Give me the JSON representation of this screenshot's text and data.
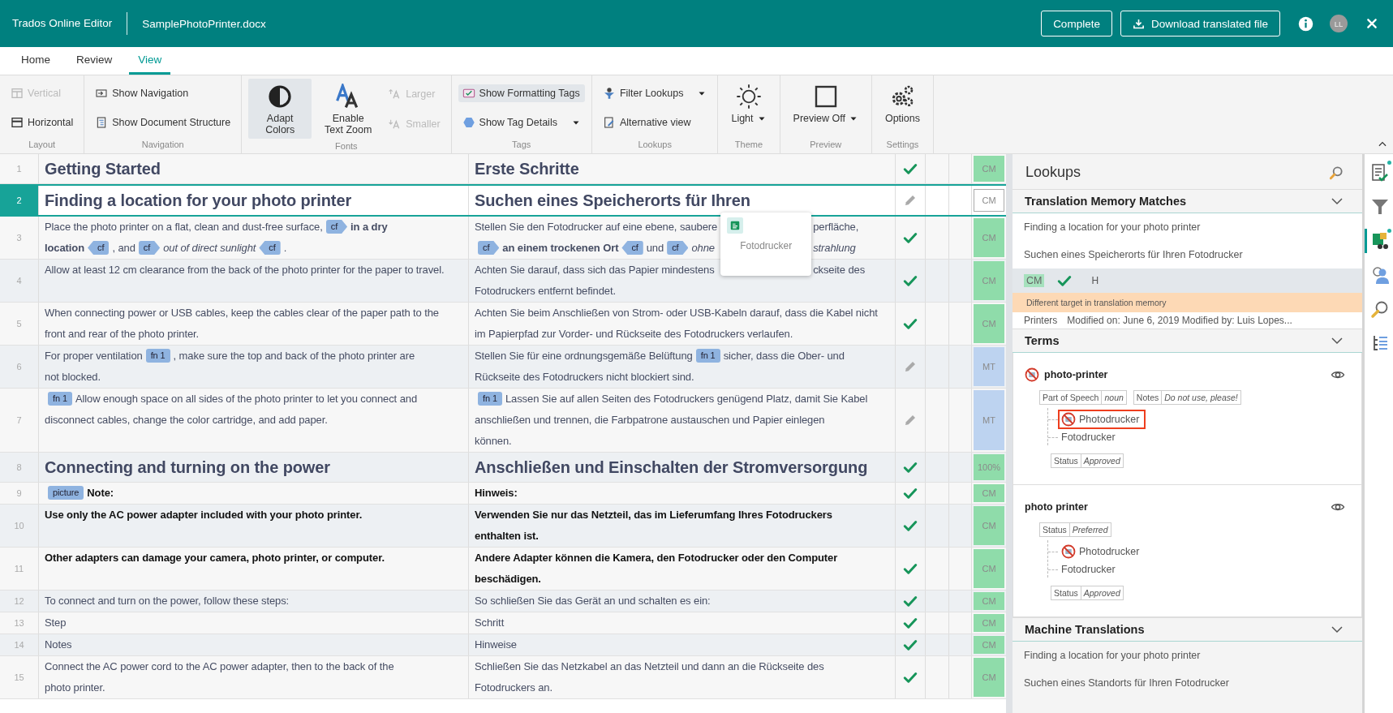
{
  "header": {
    "app_title": "Trados Online Editor",
    "file_name": "SamplePhotoPrinter.docx",
    "buttons": [
      {
        "label": "Complete",
        "kind": "plain"
      },
      {
        "label": "Download translated file",
        "kind": "download"
      }
    ],
    "avatar": "LL"
  },
  "tabs": [
    {
      "label": "Home",
      "selected": false
    },
    {
      "label": "Review",
      "selected": false
    },
    {
      "label": "View",
      "selected": true
    }
  ],
  "ribbon": {
    "groups": [
      {
        "label": "Layout",
        "items": [
          {
            "label": "Vertical",
            "kind": "small",
            "disabled": true,
            "active": false,
            "dropdown": false
          },
          {
            "label": "Horizontal",
            "kind": "small",
            "disabled": false,
            "active": false,
            "dropdown": false
          }
        ]
      },
      {
        "label": "Navigation",
        "items": [
          {
            "label": "Show Navigation",
            "kind": "small",
            "disabled": false,
            "active": false,
            "dropdown": false
          },
          {
            "label": "Show Document Structure",
            "kind": "small",
            "disabled": false,
            "active": false,
            "dropdown": false
          }
        ]
      },
      {
        "label": "Fonts",
        "items": [
          {
            "label": "Adapt Colors",
            "kind": "large",
            "disabled": false,
            "active": true,
            "dropdown": false
          },
          {
            "label": "Enable Text Zoom",
            "kind": "large",
            "disabled": false,
            "active": false,
            "dropdown": false
          },
          {
            "label": "Larger",
            "kind": "small",
            "disabled": true,
            "active": false,
            "dropdown": false
          },
          {
            "label": "Smaller",
            "kind": "small",
            "disabled": true,
            "active": false,
            "dropdown": false
          }
        ]
      },
      {
        "label": "Tags",
        "items": [
          {
            "label": "Show Formatting Tags",
            "kind": "small",
            "disabled": false,
            "active": true,
            "dropdown": false
          },
          {
            "label": "Show Tag Details",
            "kind": "small",
            "disabled": false,
            "active": false,
            "dropdown": true
          }
        ]
      },
      {
        "label": "Lookups",
        "items": [
          {
            "label": "Filter Lookups",
            "kind": "small",
            "disabled": false,
            "active": false,
            "dropdown": true
          },
          {
            "label": "Alternative view",
            "kind": "small",
            "disabled": false,
            "active": false,
            "dropdown": false
          }
        ]
      },
      {
        "label": "Theme",
        "items": [
          {
            "label": "Light",
            "kind": "large",
            "disabled": false,
            "active": false,
            "dropdown": true
          }
        ]
      },
      {
        "label": "Preview",
        "items": [
          {
            "label": "Preview Off",
            "kind": "large",
            "disabled": false,
            "active": false,
            "dropdown": true
          }
        ]
      },
      {
        "label": "Settings",
        "items": [
          {
            "label": "Options",
            "kind": "large",
            "disabled": false,
            "active": false,
            "dropdown": false
          }
        ]
      }
    ]
  },
  "rows": [
    {
      "number": "1",
      "kind": "heading",
      "selected": false,
      "confirmed": true,
      "match": "CM",
      "color": "#8fdcaa",
      "source": [
        {
          "kind": "text",
          "s": "Getting Started"
        }
      ],
      "target": [
        {
          "kind": "text",
          "s": "Erste Schritte"
        }
      ]
    },
    {
      "number": "2",
      "kind": "heading",
      "selected": true,
      "confirmed": false,
      "match": "CM",
      "color": "#ffffff",
      "source": [
        {
          "kind": "text",
          "s": "Finding a location for your photo printer"
        }
      ],
      "target": [
        {
          "kind": "text",
          "s": "Suchen eines Speicherorts für Ihren"
        }
      ]
    },
    {
      "number": "3",
      "kind": "plain",
      "selected": false,
      "confirmed": true,
      "match": "CM",
      "color": "#8fdcaa",
      "source": [
        {
          "kind": "text",
          "s": "Place the photo printer on a flat, clean and dust-free surface,"
        },
        {
          "kind": "open_tag",
          "label": "cf"
        },
        {
          "kind": "text",
          "s": "**in a dry**"
        },
        {
          "kind": "break"
        },
        {
          "kind": "text",
          "s": "**location**"
        },
        {
          "kind": "close_tag",
          "label": "cf"
        },
        {
          "kind": "text",
          "s": ", and"
        },
        {
          "kind": "open_tag",
          "label": "cf"
        },
        {
          "kind": "text",
          "s": "*out of direct sunlight*"
        },
        {
          "kind": "close_tag",
          "label": "cf"
        },
        {
          "kind": "text",
          "s": "."
        }
      ],
      "target": [
        {
          "kind": "text",
          "s": "Stellen Sie den Fotodrucker auf eine ebene, saubere"
        },
        {
          "kind": "gap"
        },
        {
          "kind": "text",
          "s": "perfläche,"
        },
        {
          "kind": "break"
        },
        {
          "kind": "open_tag",
          "label": "cf"
        },
        {
          "kind": "text",
          "s": "**an einem trockenen Ort**"
        },
        {
          "kind": "close_tag",
          "label": "cf"
        },
        {
          "kind": "text",
          "s": "und"
        },
        {
          "kind": "open_tag",
          "label": "cf"
        },
        {
          "kind": "text",
          "s": "*ohne*"
        },
        {
          "kind": "gap"
        },
        {
          "kind": "text",
          "s": "*strahlung*"
        }
      ]
    },
    {
      "number": "4",
      "kind": "plain",
      "selected": false,
      "confirmed": true,
      "match": "CM",
      "color": "#8fdcaa",
      "source": [
        {
          "kind": "text",
          "s": "Allow at least 12 cm clearance from the back of the photo printer for the paper to travel."
        }
      ],
      "target": [
        {
          "kind": "text",
          "s": "Achten Sie darauf, dass sich das Papier mindestens"
        },
        {
          "kind": "gap"
        },
        {
          "kind": "text",
          "s": "ckseite des"
        },
        {
          "kind": "break"
        },
        {
          "kind": "text",
          "s": "Fotodruckers entfernt befindet."
        }
      ]
    },
    {
      "number": "5",
      "kind": "plain",
      "selected": false,
      "confirmed": true,
      "match": "CM",
      "color": "#8fdcaa",
      "source": [
        {
          "kind": "text",
          "s": "When connecting power or USB cables, keep the cables clear of the paper path to the front and rear of the photo printer."
        }
      ],
      "target": [
        {
          "kind": "text",
          "s": "Achten Sie beim Anschließen von Strom- oder USB-Kabeln darauf, dass die Kabel nicht im Papierpfad zur Vorder- und Rückseite des Fotodruckers verlaufen."
        }
      ]
    },
    {
      "number": "6",
      "kind": "plain",
      "selected": false,
      "confirmed": false,
      "match": "MT",
      "color": "#bdd3f0",
      "source": [
        {
          "kind": "text",
          "s": "For proper ventilation"
        },
        {
          "kind": "tag",
          "label": "fn 1"
        },
        {
          "kind": "text",
          "s": ", make sure the top and back of the photo printer are"
        },
        {
          "kind": "break"
        },
        {
          "kind": "text",
          "s": "not blocked."
        }
      ],
      "target": [
        {
          "kind": "text",
          "s": "Stellen Sie für eine ordnungsgemäße Belüftung"
        },
        {
          "kind": "tag",
          "label": "fn 1"
        },
        {
          "kind": "text",
          "s": "sicher, dass die Ober- und"
        },
        {
          "kind": "break"
        },
        {
          "kind": "text",
          "s": "Rückseite des Fotodruckers nicht blockiert sind."
        }
      ]
    },
    {
      "number": "7",
      "kind": "plain",
      "selected": false,
      "confirmed": false,
      "match": "MT",
      "color": "#bdd3f0",
      "source": [
        {
          "kind": "tag",
          "label": "fn 1"
        },
        {
          "kind": "text",
          "s": "Allow enough space on all sides of the photo printer to let you connect and"
        },
        {
          "kind": "break"
        },
        {
          "kind": "text",
          "s": "disconnect cables, change the color cartridge, and add paper."
        }
      ],
      "target": [
        {
          "kind": "tag",
          "label": "fn 1"
        },
        {
          "kind": "text",
          "s": "Lassen Sie auf allen Seiten des Fotodruckers genügend Platz, damit Sie Kabel"
        },
        {
          "kind": "break"
        },
        {
          "kind": "text",
          "s": "anschließen und trennen, die Farbpatrone austauschen und Papier einlegen"
        },
        {
          "kind": "break"
        },
        {
          "kind": "text",
          "s": "können."
        }
      ]
    },
    {
      "number": "8",
      "kind": "heading",
      "selected": false,
      "confirmed": true,
      "match": "100%",
      "color": "#8fdcaa",
      "source": [
        {
          "kind": "text",
          "s": "Connecting and turning on the power"
        }
      ],
      "target": [
        {
          "kind": "text",
          "s": "Anschließen und Einschalten der Stromversorgung"
        }
      ]
    },
    {
      "number": "9",
      "kind": "bold",
      "selected": false,
      "confirmed": true,
      "match": "CM",
      "color": "#8fdcaa",
      "source": [
        {
          "kind": "tag",
          "label": "picture"
        },
        {
          "kind": "text",
          "s": "Note:"
        }
      ],
      "target": [
        {
          "kind": "text",
          "s": "Hinweis:"
        }
      ]
    },
    {
      "number": "10",
      "kind": "bold",
      "selected": false,
      "confirmed": true,
      "match": "CM",
      "color": "#8fdcaa",
      "source": [
        {
          "kind": "text",
          "s": "Use only the AC power adapter included with your photo printer."
        }
      ],
      "target": [
        {
          "kind": "text",
          "s": "Verwenden Sie nur das Netzteil, das im Lieferumfang Ihres Fotodruckers"
        },
        {
          "kind": "break"
        },
        {
          "kind": "text",
          "s": "enthalten ist."
        }
      ]
    },
    {
      "number": "11",
      "kind": "bold",
      "selected": false,
      "confirmed": true,
      "match": "CM",
      "color": "#8fdcaa",
      "source": [
        {
          "kind": "text",
          "s": "Other adapters can damage your camera, photo printer, or computer."
        }
      ],
      "target": [
        {
          "kind": "text",
          "s": "Andere Adapter können die Kamera, den Fotodrucker oder den Computer beschädigen."
        }
      ]
    },
    {
      "number": "12",
      "kind": "plain",
      "selected": false,
      "confirmed": true,
      "match": "CM",
      "color": "#8fdcaa",
      "source": [
        {
          "kind": "text",
          "s": "To connect and turn on the power, follow these steps:"
        }
      ],
      "target": [
        {
          "kind": "text",
          "s": "So schließen Sie das Gerät an und schalten es ein:"
        }
      ]
    },
    {
      "number": "13",
      "kind": "plain",
      "selected": false,
      "confirmed": true,
      "match": "CM",
      "color": "#8fdcaa",
      "source": [
        {
          "kind": "text",
          "s": "Step"
        }
      ],
      "target": [
        {
          "kind": "text",
          "s": "Schritt"
        }
      ]
    },
    {
      "number": "14",
      "kind": "plain",
      "selected": false,
      "confirmed": true,
      "match": "CM",
      "color": "#8fdcaa",
      "source": [
        {
          "kind": "text",
          "s": "Notes"
        }
      ],
      "target": [
        {
          "kind": "text",
          "s": "Hinweise"
        }
      ]
    },
    {
      "number": "15",
      "kind": "plain",
      "selected": false,
      "confirmed": true,
      "match": "CM",
      "color": "#8fdcaa",
      "source": [
        {
          "kind": "text",
          "s": "Connect the AC power cord to the AC power adapter, then to the back of the"
        },
        {
          "kind": "break"
        },
        {
          "kind": "text",
          "s": "photo printer."
        }
      ],
      "target": [
        {
          "kind": "text",
          "s": "Schließen Sie das Netzkabel an das Netzteil und dann an die Rückseite des"
        },
        {
          "kind": "break"
        },
        {
          "kind": "text",
          "s": "Fotodruckers an."
        }
      ]
    }
  ],
  "suggestion_popup": {
    "text": "Fotodrucker"
  },
  "lookups": {
    "title": "Lookups",
    "tm": {
      "title": "Translation Memory Matches",
      "source": "Finding a location for your photo printer",
      "target": "Suchen eines Speicherorts für Ihren Fotodrucker",
      "match": "CM",
      "confirmed": true,
      "origin": "H",
      "warning": "Different target in translation memory",
      "tm_name": "Printers",
      "modified": "Modified on: June 6, 2019 Modified by: Luis Lopes..."
    },
    "terms": {
      "title": "Terms",
      "entries": [
        {
          "term": "photo-printer",
          "forbidden": true,
          "fields": [
            {
              "label": "Part of Speech",
              "value": "noun"
            },
            {
              "label": "Notes",
              "value": "Do not use, please!"
            }
          ],
          "translations": [
            {
              "text": "Photodrucker",
              "forbidden": true,
              "highlighted": true
            },
            {
              "text": "Fotodrucker",
              "forbidden": false,
              "highlighted": false
            }
          ],
          "status_fields": [
            {
              "label": "Status",
              "value": "Approved"
            }
          ]
        },
        {
          "term": "photo printer",
          "forbidden": false,
          "fields": [
            {
              "label": "Status",
              "value": "Preferred"
            }
          ],
          "translations": [
            {
              "text": "Photodrucker",
              "forbidden": true,
              "highlighted": false
            },
            {
              "text": "Fotodrucker",
              "forbidden": false,
              "highlighted": false
            }
          ],
          "status_fields": [
            {
              "label": "Status",
              "value": "Approved"
            }
          ]
        }
      ]
    },
    "mt": {
      "title": "Machine Translations",
      "source": "Finding a location for your photo printer",
      "target": "Suchen eines Standorts für Ihren Fotodrucker"
    }
  },
  "side_tools": [
    {
      "selected": false,
      "notification": true
    },
    {
      "selected": false,
      "notification": false
    },
    {
      "selected": true,
      "notification": true
    },
    {
      "selected": false,
      "notification": false
    },
    {
      "selected": false,
      "notification": false
    },
    {
      "selected": false,
      "notification": false
    }
  ]
}
